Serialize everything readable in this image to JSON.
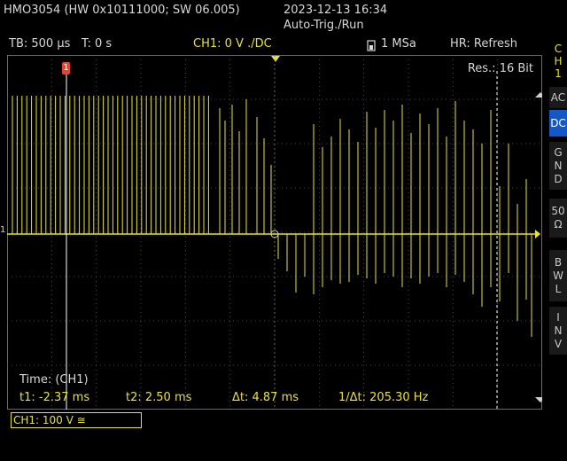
{
  "header": {
    "device": "HMO3054 (HW 0x10111000; SW 06.005)",
    "datetime": "2023-12-13 16:34",
    "trigger_mode": "Auto-Trig./Run"
  },
  "status_bar": {
    "timebase": "TB: 500 µs",
    "time_offset": "T: 0 s",
    "channel_setting": "CH1: 0 V ./DC",
    "sample_rate": "1 MSa",
    "refresh": "HR: Refresh"
  },
  "screen": {
    "resolution": "Res.: 16 Bit",
    "time_label": "Time: (CH1)",
    "ground_marker": "1",
    "cursor1_marker": "1"
  },
  "measurements": {
    "t1": "t1: -2.37 ms",
    "t2": "t2: 2.50 ms",
    "dt": "Δt: 4.87 ms",
    "inv_dt": "1/Δt: 205.30 Hz"
  },
  "channel_box": "CH1: 100 V ≅",
  "sidebar": {
    "channel": [
      "C",
      "H",
      "1"
    ],
    "buttons": [
      {
        "label": [
          "AC"
        ],
        "active": false
      },
      {
        "label": [
          "DC"
        ],
        "active": true
      },
      {
        "label": [
          "G",
          "N",
          "D"
        ],
        "active": false
      },
      {
        "label": [
          "50",
          "Ω"
        ],
        "active": false
      },
      {
        "label": [
          "B",
          "W",
          "L"
        ],
        "active": false
      },
      {
        "label": [
          "I",
          "N",
          "V"
        ],
        "active": false
      }
    ]
  },
  "colors": {
    "trace": "#e8e236",
    "grid": "#5a5a5a",
    "active_button": "#1457c9"
  }
}
